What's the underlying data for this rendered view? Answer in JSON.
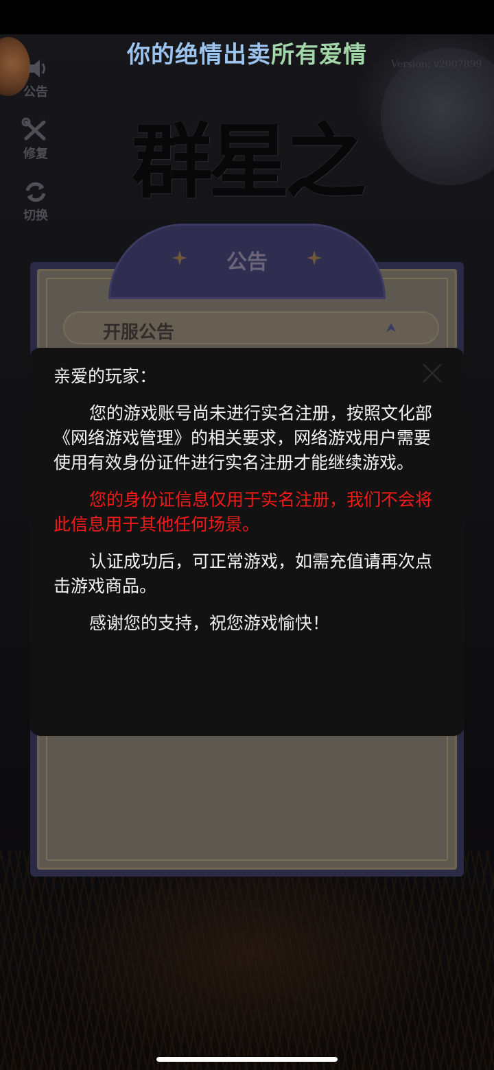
{
  "headline": {
    "part1": "你的绝情",
    "part2": "出卖",
    "part3": "所有爱情"
  },
  "version": "Version: v2007899",
  "logo_title": "群星之子",
  "side_menu": [
    {
      "label": "公告",
      "icon": "speaker-icon"
    },
    {
      "label": "修复",
      "icon": "wrench-icon"
    },
    {
      "label": "切换",
      "icon": "switch-icon"
    }
  ],
  "notice": {
    "title": "公告",
    "section_title": "开服公告"
  },
  "modal": {
    "greeting": "亲爱的玩家：",
    "paragraph1": "您的游戏账号尚未进行实名注册，按照文化部《网络游戏管理》的相关要求，网络游戏用户需要使用有效身份证件进行实名注册才能继续游戏。",
    "paragraph2": "您的身份证信息仅用于实名注册，我们不会将此信息用于其他任何场景。",
    "paragraph3": "认证成功后，可正常游戏，如需充值请再次点击游戏商品。",
    "paragraph4": "感谢您的支持，祝您游戏愉快！"
  },
  "colors": {
    "warning_text": "#f31a1a",
    "modal_bg": "#121212",
    "headline_blue": "#9cc4ef",
    "headline_green": "#a3d6a8"
  }
}
